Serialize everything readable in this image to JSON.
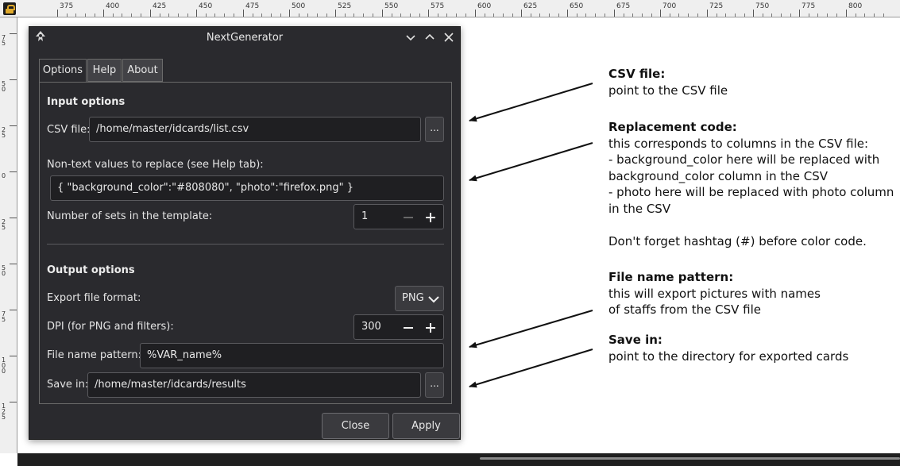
{
  "ruler": {
    "top_labels": [
      "375",
      "400",
      "425",
      "450",
      "475",
      "500",
      "525",
      "550",
      "575",
      "600",
      "625",
      "650",
      "675",
      "700",
      "725",
      "750",
      "775",
      "800"
    ],
    "left_labels": [
      "7 5",
      "5 0",
      "2 5",
      "0",
      "2 5",
      "5 0",
      "7 5",
      "1 0 0",
      "1 2 5"
    ]
  },
  "dialog": {
    "title": "NextGenerator",
    "tabs": [
      "Options",
      "Help",
      "About"
    ],
    "input_options": {
      "heading": "Input options",
      "csv_label": "CSV file:",
      "csv_value": "/home/master/idcards/list.csv",
      "browse_label": "...",
      "nontext_label": "Non-text values to replace (see Help tab):",
      "nontext_value": "{ \"background_color\":\"#808080\", \"photo\":\"firefox.png\" }",
      "sets_label": "Number of sets in the template:",
      "sets_value": "1"
    },
    "output_options": {
      "heading": "Output options",
      "format_label": "Export file format:",
      "format_value": "PNG",
      "dpi_label": "DPI (for PNG and filters):",
      "dpi_value": "300",
      "pattern_label": "File name pattern:",
      "pattern_value": "%VAR_name%",
      "save_label": "Save in:",
      "save_value": "/home/master/idcards/results",
      "browse_label": "..."
    },
    "close_label": "Close",
    "apply_label": "Apply"
  },
  "annotations": {
    "csv": {
      "title": "CSV file:",
      "lines": [
        "point to the CSV file"
      ]
    },
    "replacement": {
      "title": "Replacement code:",
      "lines": [
        "this corresponds to columns in the CSV file:",
        "- background_color here will be replaced with",
        "background_color column in the CSV",
        "- photo here will be replaced with photo column",
        "in the CSV",
        "",
        "Don't forget hashtag (#) before color code."
      ]
    },
    "pattern": {
      "title": "File name pattern:",
      "lines": [
        "this will export pictures with names",
        "of staffs from the CSV file"
      ]
    },
    "save": {
      "title": "Save in:",
      "lines": [
        "point to the directory for exported cards"
      ]
    }
  },
  "colors": {
    "dialog_bg": "#2a2a2e",
    "field_bg": "#1f1f22",
    "border": "#5a5a5e",
    "text": "#e6e6e6",
    "arrow": "#111111"
  }
}
